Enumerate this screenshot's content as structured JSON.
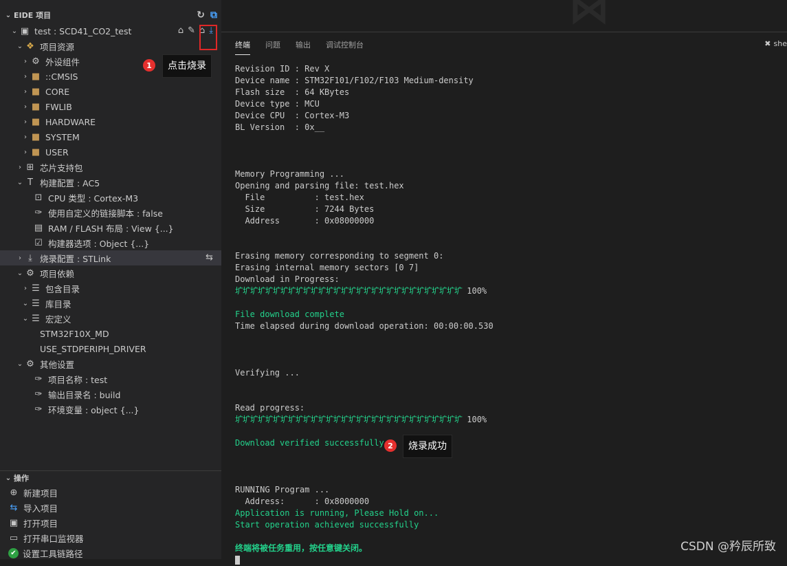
{
  "sidebar": {
    "title": "EIDE 项目",
    "header_icons": [
      "refresh-icon",
      "windows-icon"
    ],
    "project": {
      "label": "test : SCD41_CO2_test",
      "action_icons": [
        "build-icon",
        "clean-icon",
        "rebuild-icon",
        "download-icon"
      ]
    },
    "resources": {
      "label": "项目资源",
      "items": [
        {
          "label": "外设组件",
          "icon": "components-icon"
        },
        {
          "label": "::CMSIS",
          "icon": "folder-icon"
        },
        {
          "label": "CORE",
          "icon": "folder-icon"
        },
        {
          "label": "FWLIB",
          "icon": "folder-icon"
        },
        {
          "label": "HARDWARE",
          "icon": "folder-icon"
        },
        {
          "label": "SYSTEM",
          "icon": "folder-icon"
        },
        {
          "label": "USER",
          "icon": "folder-icon"
        }
      ]
    },
    "chip_pkg": "芯片支持包",
    "build_config": {
      "label": "构建配置 : AC5",
      "items": [
        "CPU 类型 : Cortex-M3",
        "使用自定义的链接脚本 : false",
        "RAM / FLASH 布局 : View {...}",
        "构建器选项 : Object {...}"
      ]
    },
    "flash_config": "烧录配置 : STLink",
    "deps": {
      "label": "项目依赖",
      "include": "包含目录",
      "lib": "库目录",
      "macro": "宏定义",
      "macros": [
        "STM32F10X_MD",
        "USE_STDPERIPH_DRIVER"
      ]
    },
    "other": {
      "label": "其他设置",
      "items": [
        "项目名称 : test",
        "输出目录名 : build",
        "环境变量 : object {...}"
      ]
    },
    "ops": {
      "title": "操作",
      "items": [
        "新建项目",
        "导入项目",
        "打开项目",
        "打开串口监视器",
        "设置工具链路径"
      ]
    }
  },
  "panel": {
    "tabs": [
      "终端",
      "问题",
      "输出",
      "调试控制台"
    ],
    "active_tab": "终端",
    "shell_label": "she"
  },
  "terminal": {
    "lines": [
      "Revision ID : Rev X",
      "Device name : STM32F101/F102/F103 Medium-density",
      "Flash size  : 64 KBytes",
      "Device type : MCU",
      "Device CPU  : Cortex-M3",
      "BL Version  : 0x__",
      "",
      "",
      "",
      "Memory Programming ...",
      "Opening and parsing file: test.hex",
      "  File          : test.hex",
      "  Size          : 7244 Bytes",
      "  Address       : 0x08000000",
      "",
      "",
      "Erasing memory corresponding to segment 0:",
      "Erasing internal memory sectors [0 7]",
      "Download in Progress:"
    ],
    "progress_bar": "圹圹圹圹圹圹圹圹圹圹圹圹圹圹圹圹圹圹圹圹圹圹圹圹圹圹圹圹圹圹",
    "progress_pct": "100%",
    "download_complete": "File download complete",
    "elapsed": "Time elapsed during download operation: 00:00:00.530",
    "verifying": "Verifying ...",
    "read_progress": "Read progress:",
    "verified": "Download verified successfully",
    "running": "RUNNING Program ...",
    "running_addr": "  Address:      : 0x8000000",
    "app_running": "Application is running, Please Hold on...",
    "start_ok": "Start operation achieved successfully",
    "reuse_msg": "终端将被任务重用，按任意键关闭。"
  },
  "annotations": {
    "badge1": "1",
    "callout1": "点击烧录",
    "badge2": "2",
    "callout2": "烧录成功"
  },
  "watermark": "CSDN @矜辰所致"
}
